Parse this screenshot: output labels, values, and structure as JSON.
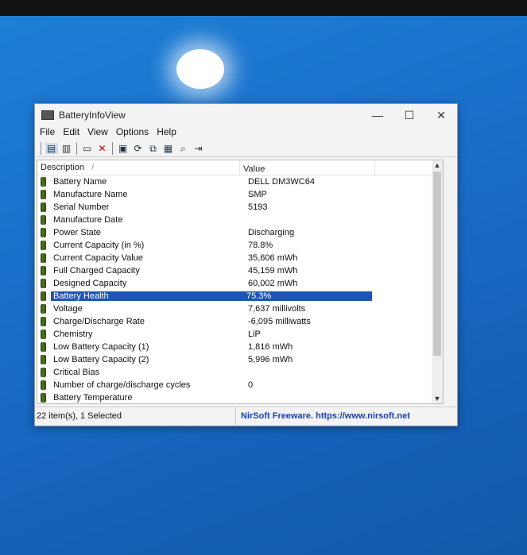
{
  "window": {
    "title": "BatteryInfoView",
    "minimize": "—",
    "maximize": "☐",
    "close": "✕"
  },
  "menu": [
    "File",
    "Edit",
    "View",
    "Options",
    "Help"
  ],
  "toolbar": [
    {
      "icon": "view-icon",
      "glyph": "▤"
    },
    {
      "icon": "clipboard-icon",
      "glyph": "▥"
    },
    {
      "icon": "window-icon",
      "glyph": "▭"
    },
    {
      "icon": "delete-icon",
      "glyph": "✕"
    },
    {
      "icon": "save-icon",
      "glyph": "▣"
    },
    {
      "icon": "refresh-icon",
      "glyph": "⟳"
    },
    {
      "icon": "copy-icon",
      "glyph": "⧉"
    },
    {
      "icon": "properties-icon",
      "glyph": "▦"
    },
    {
      "icon": "find-icon",
      "glyph": "⌕"
    },
    {
      "icon": "exit-icon",
      "glyph": "⇥"
    }
  ],
  "columns": {
    "description": "Description",
    "sort": "/",
    "value": "Value"
  },
  "rows": [
    {
      "d": "Battery Name",
      "v": "DELL DM3WC64"
    },
    {
      "d": "Manufacture Name",
      "v": "SMP"
    },
    {
      "d": "Serial Number",
      "v": "5193"
    },
    {
      "d": "Manufacture Date",
      "v": ""
    },
    {
      "d": "Power State",
      "v": "Discharging"
    },
    {
      "d": "Current Capacity (in %)",
      "v": "78.8%"
    },
    {
      "d": "Current Capacity Value",
      "v": "35,606 mWh"
    },
    {
      "d": "Full Charged Capacity",
      "v": "45,159 mWh"
    },
    {
      "d": "Designed Capacity",
      "v": "60,002 mWh"
    },
    {
      "d": "Battery Health",
      "v": "75.3%"
    },
    {
      "d": "Voltage",
      "v": "7,637 millivolts"
    },
    {
      "d": "Charge/Discharge Rate",
      "v": "-6,095 milliwatts"
    },
    {
      "d": "Chemistry",
      "v": "LiP"
    },
    {
      "d": "Low Battery Capacity (1)",
      "v": "1,816 mWh"
    },
    {
      "d": "Low Battery Capacity (2)",
      "v": "5,996 mWh"
    },
    {
      "d": "Critical Bias",
      "v": ""
    },
    {
      "d": "Number of charge/discharge cycles",
      "v": "0"
    },
    {
      "d": "Battery Temperature",
      "v": ""
    }
  ],
  "selected_index": 9,
  "status": {
    "count": "22 item(s), 1 Selected",
    "link": "NirSoft Freeware. https://www.nirsoft.net"
  }
}
